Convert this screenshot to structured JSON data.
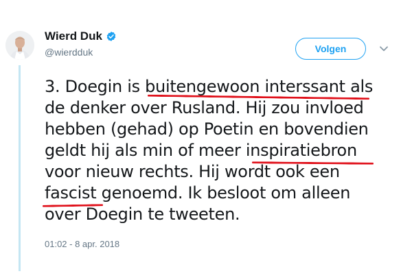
{
  "tweet": {
    "author": {
      "display_name": "Wierd Duk",
      "handle": "@wierdduk",
      "verified": true,
      "avatar_icon": "avatar-photo"
    },
    "follow_button": {
      "label": "Volgen"
    },
    "menu_icon": "chevron-down-icon",
    "text_lines": [
      "3. Doegin is buitengewoon interssant als",
      "de denker over Rusland. Hij zou invloed",
      "hebben (gehad) op Poetin en bovendien",
      "geldt hij als min of meer inspiratiebron",
      "voor nieuw rechts. Hij wordt ook een",
      "fascist genoemd. Ik besloot om alleen",
      "over Doegin te tweeten."
    ],
    "timestamp": "01:02 - 8 apr. 2018"
  },
  "colors": {
    "accent": "#1da1f2",
    "underline": "#e0101a",
    "muted": "#657786",
    "thread_line": "#c4e6f3"
  }
}
